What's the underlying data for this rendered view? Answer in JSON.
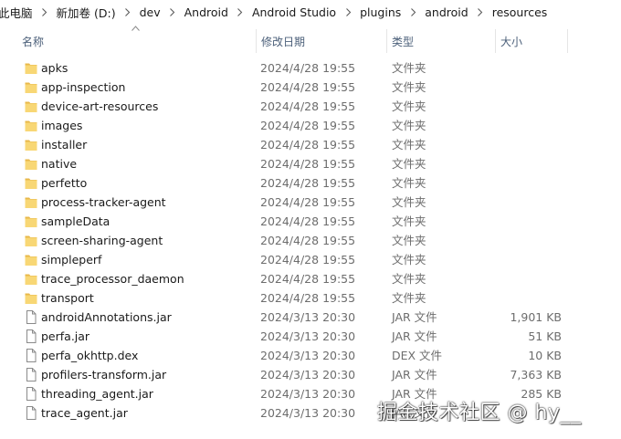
{
  "breadcrumb": [
    "此电脑",
    "新加卷 (D:)",
    "dev",
    "Android",
    "Android Studio",
    "plugins",
    "android",
    "resources"
  ],
  "columns": {
    "name": "名称",
    "date": "修改日期",
    "type": "类型",
    "size": "大小"
  },
  "files": [
    {
      "name": "apks",
      "date": "2024/4/28 19:55",
      "type": "文件夹",
      "size": "",
      "icon": "folder-icon"
    },
    {
      "name": "app-inspection",
      "date": "2024/4/28 19:55",
      "type": "文件夹",
      "size": "",
      "icon": "folder-icon"
    },
    {
      "name": "device-art-resources",
      "date": "2024/4/28 19:55",
      "type": "文件夹",
      "size": "",
      "icon": "folder-icon"
    },
    {
      "name": "images",
      "date": "2024/4/28 19:55",
      "type": "文件夹",
      "size": "",
      "icon": "folder-icon"
    },
    {
      "name": "installer",
      "date": "2024/4/28 19:55",
      "type": "文件夹",
      "size": "",
      "icon": "folder-icon"
    },
    {
      "name": "native",
      "date": "2024/4/28 19:55",
      "type": "文件夹",
      "size": "",
      "icon": "folder-icon"
    },
    {
      "name": "perfetto",
      "date": "2024/4/28 19:55",
      "type": "文件夹",
      "size": "",
      "icon": "folder-icon"
    },
    {
      "name": "process-tracker-agent",
      "date": "2024/4/28 19:55",
      "type": "文件夹",
      "size": "",
      "icon": "folder-icon"
    },
    {
      "name": "sampleData",
      "date": "2024/4/28 19:55",
      "type": "文件夹",
      "size": "",
      "icon": "folder-icon"
    },
    {
      "name": "screen-sharing-agent",
      "date": "2024/4/28 19:55",
      "type": "文件夹",
      "size": "",
      "icon": "folder-icon"
    },
    {
      "name": "simpleperf",
      "date": "2024/4/28 19:55",
      "type": "文件夹",
      "size": "",
      "icon": "folder-icon"
    },
    {
      "name": "trace_processor_daemon",
      "date": "2024/4/28 19:55",
      "type": "文件夹",
      "size": "",
      "icon": "folder-icon"
    },
    {
      "name": "transport",
      "date": "2024/4/28 19:55",
      "type": "文件夹",
      "size": "",
      "icon": "folder-icon"
    },
    {
      "name": "androidAnnotations.jar",
      "date": "2024/3/13 20:30",
      "type": "JAR 文件",
      "size": "1,901 KB",
      "icon": "file-icon"
    },
    {
      "name": "perfa.jar",
      "date": "2024/3/13 20:30",
      "type": "JAR 文件",
      "size": "51 KB",
      "icon": "file-icon"
    },
    {
      "name": "perfa_okhttp.dex",
      "date": "2024/3/13 20:30",
      "type": "DEX 文件",
      "size": "10 KB",
      "icon": "file-icon"
    },
    {
      "name": "profilers-transform.jar",
      "date": "2024/3/13 20:30",
      "type": "JAR 文件",
      "size": "7,363 KB",
      "icon": "file-icon"
    },
    {
      "name": "threading_agent.jar",
      "date": "2024/3/13 20:30",
      "type": "JAR 文件",
      "size": "285 KB",
      "icon": "file-icon"
    },
    {
      "name": "trace_agent.jar",
      "date": "2024/3/13 20:30",
      "type": "JAR 文件",
      "size": "",
      "icon": "file-icon"
    }
  ],
  "watermark": "掘金技术社区 @ hy__",
  "colors": {
    "folder": "#f8d775",
    "folder_dark": "#e8b84a",
    "header_text": "#4c607a",
    "secondary_text": "#6d6d6d"
  }
}
